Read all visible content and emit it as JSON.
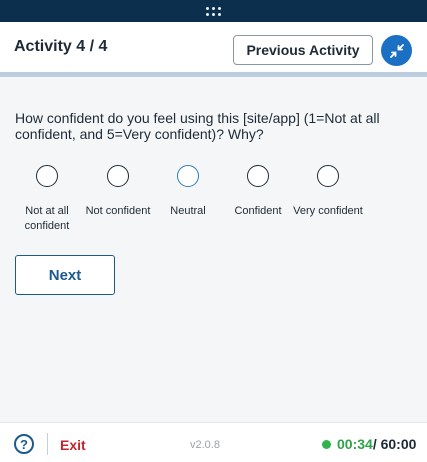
{
  "colors": {
    "topbar": "#0d2f4e",
    "accent": "#1c70c4",
    "exit": "#c0262d",
    "timer_green": "#2fa24a"
  },
  "header": {
    "title": "Activity 4 / 4",
    "previous_label": "Previous Activity",
    "collapse_icon": "collapse-arrows-icon"
  },
  "question": {
    "text": "How confident do you feel using this [site/app] (1=Not at all confident, and 5=Very confident)? Why?",
    "options": [
      {
        "label": "Not at all confident"
      },
      {
        "label": "Not confident"
      },
      {
        "label": "Neutral"
      },
      {
        "label": "Confident"
      },
      {
        "label": "Very confident"
      }
    ]
  },
  "next_label": "Next",
  "footer": {
    "help_icon": "help-icon",
    "help_glyph": "?",
    "exit_label": "Exit",
    "version": "v2.0.8",
    "elapsed": "00:34",
    "total": "/ 60:00"
  }
}
